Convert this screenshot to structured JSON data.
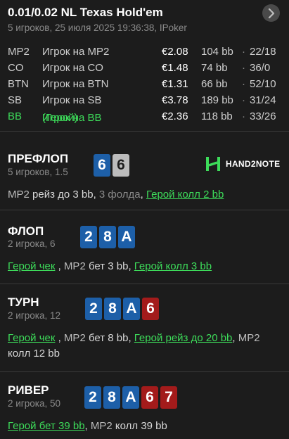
{
  "header": {
    "title": "0.01/0.02 NL Texas Hold'em",
    "subtitle": "5 игроков, 25 июля 2025 19:36:38, IPoker"
  },
  "players": [
    {
      "pos": "MP2",
      "name": "Игрок на MP2",
      "stack": "€2.08",
      "bb": "104 bb",
      "stats": "22/18"
    },
    {
      "pos": "CO",
      "name": "Игрок на CO",
      "stack": "€1.48",
      "bb": "74 bb",
      "stats": "36/0"
    },
    {
      "pos": "BTN",
      "name": "Игрок на BTN",
      "stack": "€1.31",
      "bb": "66 bb",
      "stats": "52/10"
    },
    {
      "pos": "SB",
      "name": "Игрок на SB",
      "stack": "€3.78",
      "bb": "189 bb",
      "stats": "31/24"
    },
    {
      "pos": "BB",
      "name": "Игрок на BB",
      "hero_tag": "(Герой)",
      "stack": "€2.36",
      "bb": "118 bb",
      "stats": "33/26"
    }
  ],
  "logo": {
    "text": "HAND2NOTE"
  },
  "preflop": {
    "title": "ПРЕФЛОП",
    "sub": "5 игроков, 1.5",
    "cards": [
      {
        "rank": "6",
        "color": "blue"
      },
      {
        "rank": "6",
        "color": "gray"
      }
    ],
    "action": {
      "p1": "MP2",
      "t1": " рейз до 3 bb, ",
      "t2": "3 фолда",
      "t3": ", ",
      "hero": "Герой колл 2 bb"
    }
  },
  "flop": {
    "title": "ФЛОП",
    "sub": "2 игрока, 6",
    "cards": [
      {
        "rank": "2",
        "color": "blue"
      },
      {
        "rank": "8",
        "color": "blue"
      },
      {
        "rank": "A",
        "color": "blue"
      }
    ],
    "action": {
      "hero1": "Герой чек",
      "sep1": " , ",
      "p1": "MP2",
      "t1": " бет 3 bb, ",
      "hero2": "Герой колл 3 bb"
    }
  },
  "turn": {
    "title": "ТУРН",
    "sub": "2 игрока, 12",
    "cards": [
      {
        "rank": "2",
        "color": "blue"
      },
      {
        "rank": "8",
        "color": "blue"
      },
      {
        "rank": "A",
        "color": "blue"
      },
      {
        "rank": "6",
        "color": "red"
      }
    ],
    "action": {
      "hero1": "Герой чек",
      "sep1": " , ",
      "p1": "MP2",
      "t1": " бет 8 bb, ",
      "hero2": "Герой рейз до 20 bb",
      "sep2": ", ",
      "p2": "MP2",
      "t2": " колл 12 bb"
    }
  },
  "river": {
    "title": "РИВЕР",
    "sub": "2 игрока, 50",
    "cards": [
      {
        "rank": "2",
        "color": "blue"
      },
      {
        "rank": "8",
        "color": "blue"
      },
      {
        "rank": "A",
        "color": "blue"
      },
      {
        "rank": "6",
        "color": "red"
      },
      {
        "rank": "7",
        "color": "red"
      }
    ],
    "action": {
      "hero1": "Герой бет 39 bb",
      "sep1": ", ",
      "p1": "MP2",
      "t1": " колл 39 bb"
    }
  },
  "colors": {
    "hero": "#3ddc5a",
    "card_blue": "#1d5fa8",
    "card_red": "#a31b1b",
    "card_gray": "#bcbcbc",
    "background": "#1c1c1c"
  },
  "icons": {
    "nav": "chevron-right-icon",
    "logo": "hand2note-logo-icon"
  }
}
